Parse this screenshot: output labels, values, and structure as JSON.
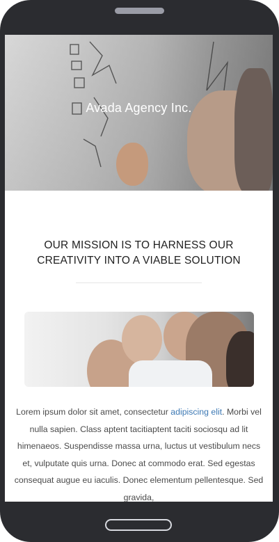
{
  "hero": {
    "title": "Avada Agency Inc."
  },
  "mission": {
    "line1": "OUR MISSION IS TO HARNESS OUR",
    "line2": "CREATIVITY INTO A VIABLE SOLUTION"
  },
  "content": {
    "text_start": "Lorem ipsum dolor sit amet, consectetur ",
    "link_text": "adipiscing elit",
    "text_end": ". Morbi vel nulla sapien. Class aptent tacitiaptent taciti sociosqu ad lit himenaeos. Suspendisse massa urna, luctus ut vestibulum necs et, vulputate quis urna. Donec at commodo erat. Sed egestas consequat augue eu iaculis. Donec elementum pellentesque. Sed gravida,"
  },
  "colors": {
    "phone": "#2b2c30",
    "link": "#3c78b4",
    "text": "#4a4a4a"
  }
}
